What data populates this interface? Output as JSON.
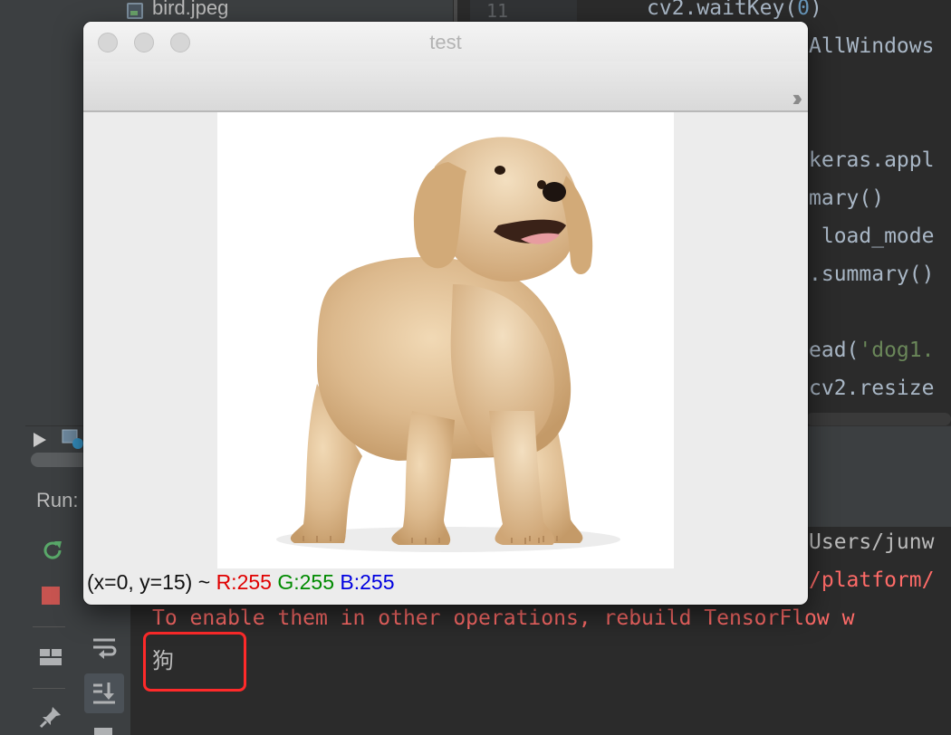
{
  "ide": {
    "project_file": "bird.jpeg",
    "line_number": "11",
    "code_lines": [
      {
        "pre": "cv2.waitKey(",
        "num": "0",
        "post": ")"
      },
      {
        "text": "AllWindows"
      },
      {
        "text": "keras.appl"
      },
      {
        "text": "mary()"
      },
      {
        "text": " load_mode"
      },
      {
        "text": ".summary()"
      },
      {
        "pre": "ead(",
        "str": "'dog1.",
        "post": ""
      },
      {
        "text": "cv2.resize"
      }
    ],
    "run_tab_label": "Run:",
    "console_lines": [
      "Users/junw",
      "/platform/",
      "To enable them in other operations, rebuild TensorFlow w"
    ],
    "result": "狗"
  },
  "window": {
    "title": "test",
    "status": {
      "coords": "(x=0, y=15) ~ ",
      "r": "R:255",
      "g": "G:255",
      "b": "B:255"
    }
  },
  "icons": {
    "more": "chevrons-right-icon",
    "rerun": "rerun-icon",
    "stop": "stop-icon",
    "layout": "layout-icon",
    "pin": "pin-icon",
    "soft_wrap": "soft-wrap-icon",
    "scroll_end": "scroll-to-end-icon"
  },
  "colors": {
    "highlight": "#ff2a2a",
    "error_text": "#ff6b68",
    "r": "#e00000",
    "g": "#008a00",
    "b": "#0000e0"
  }
}
